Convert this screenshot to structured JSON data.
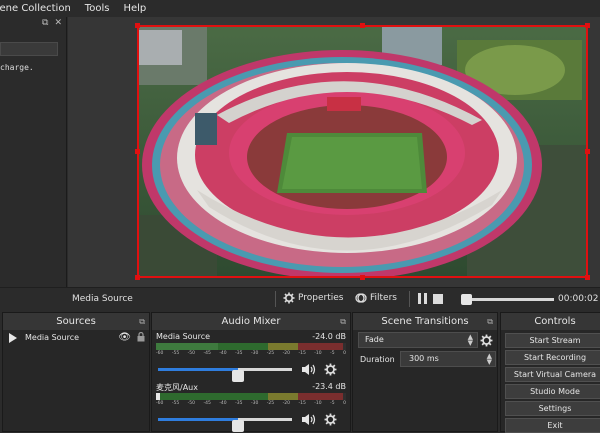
{
  "menu": {
    "scene_collection": "cene Collection",
    "tools": "Tools",
    "help": "Help"
  },
  "left_dock": {
    "log_text": "charge."
  },
  "context_bar": {
    "source_name": "Media Source",
    "properties": "Properties",
    "filters": "Filters",
    "time": "00:00:02"
  },
  "sources": {
    "title": "Sources",
    "items": [
      {
        "label": "Media Source"
      }
    ]
  },
  "mixer": {
    "title": "Audio Mixer",
    "scale": [
      "-60",
      "-55",
      "-50",
      "-45",
      "-40",
      "-35",
      "-30",
      "-25",
      "-20",
      "-15",
      "-10",
      "-5",
      "0"
    ],
    "channels": [
      {
        "name": "Media Source",
        "db": "-24.0 dB",
        "level": 0.6
      },
      {
        "name": "麦克风/Aux",
        "db": "-23.4 dB",
        "level": 0.6
      }
    ]
  },
  "transitions": {
    "title": "Scene Transitions",
    "selected": "Fade",
    "duration_label": "Duration",
    "duration_value": "300 ms"
  },
  "controls": {
    "title": "Controls",
    "buttons": [
      "Start Stream",
      "Start Recording",
      "Start Virtual Camera",
      "Studio Mode",
      "Settings",
      "Exit"
    ]
  },
  "colors": {
    "selection": "#e01010",
    "accent": "#2f7dde"
  }
}
